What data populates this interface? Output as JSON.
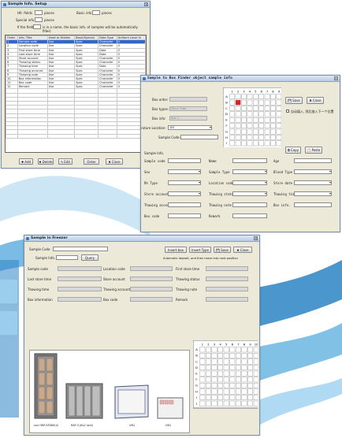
{
  "colors": {
    "accent": "#3168c6",
    "selected_cell": "#e02020",
    "window_bg": "#ece9d8",
    "swoosh": "#2c84c4"
  },
  "win1": {
    "title": "Sample Info. Setup",
    "top": {
      "hfr_fields_label": "Hfr. fields",
      "pieces1": "pieces",
      "basic_info_label": "Basic info",
      "pieces2": "pieces",
      "special_info_label": "Special info",
      "pieces3": "pieces",
      "if_the_field_label": "If the field",
      "note": "is in a name, the basic info. of samples will be automatically filled."
    },
    "columns": [
      "Order",
      "Info. Title",
      "Used or Hidden",
      "Basic/Special",
      "Data Type",
      "Uniform Level In"
    ],
    "rows": [
      [
        "1",
        "Sample code",
        "Use",
        "Spec",
        "Character",
        "0"
      ],
      [
        "2",
        "Location code",
        "Use",
        "Spec",
        "Character",
        "0"
      ],
      [
        "3",
        "First store time",
        "Use",
        "Spec",
        "Date",
        "0"
      ],
      [
        "4",
        "Last store time",
        "Use",
        "Spec",
        "Date",
        "0"
      ],
      [
        "5",
        "Store account",
        "Use",
        "Spec",
        "Character",
        "0"
      ],
      [
        "6",
        "Thawing status",
        "Use",
        "Spec",
        "Character",
        "0"
      ],
      [
        "7",
        "Thawing time",
        "Use",
        "Spec",
        "Date",
        "0"
      ],
      [
        "8",
        "Thawing account",
        "Use",
        "Spec",
        "Character",
        "0"
      ],
      [
        "9",
        "Thawing note",
        "Use",
        "Spec",
        "Character",
        "0"
      ],
      [
        "10",
        "Box information",
        "Use",
        "Spec",
        "Character",
        "0"
      ],
      [
        "11",
        "Box code",
        "Use",
        "Spec",
        "Character",
        "0"
      ],
      [
        "12",
        "Remark",
        "Use",
        "Spec",
        "Character",
        "0"
      ]
    ],
    "buttons": {
      "add": "Add",
      "delete": "Delete",
      "edit": "Edit",
      "order": "Order",
      "close": "Close"
    }
  },
  "win2": {
    "title": "Sample to Box Finder object sample info",
    "fields": {
      "box_order": "Box order:",
      "box_types": "Box types:",
      "box_types_value": "Micro Tube",
      "box_info": "Box info:",
      "box_info_value": "Box 1",
      "temp_label": "rature Location:",
      "temp_value": "-80",
      "sample_code": "Sample Code:"
    },
    "buttons": {
      "save": "Save",
      "close": "Close",
      "copy": "Copy",
      "paste": "Paste"
    },
    "check_label": "自动填入, 然后放入下一个位置",
    "sample_info_label": "Sample Info.",
    "grid_cols": [
      "1",
      "2",
      "3",
      "4",
      "5",
      "6",
      "7",
      "8",
      "9"
    ],
    "grid_rows": [
      "A",
      "B",
      "C",
      "D",
      "E",
      "F",
      "G",
      "H",
      "I"
    ],
    "form": [
      [
        "Sample code",
        "Name",
        "Age"
      ],
      [
        "Sex",
        "Sample Type",
        "Blood Type"
      ],
      [
        "Rh Type",
        "Location code",
        "Store date"
      ],
      [
        "Store account",
        "Thawing state",
        "Thawing time"
      ],
      [
        "Thawing acces",
        "Thawing note",
        "Box info."
      ],
      [
        "Box code",
        "Remark",
        ""
      ]
    ]
  },
  "win3": {
    "title": "Sample in Freezer",
    "sample_code_label": "Sample Code",
    "sample_info_label": "Sample Info.",
    "query_btn": "Query",
    "top_buttons": {
      "insert": "Insert box",
      "insert_type": "Insert Type",
      "save": "Save",
      "close": "Close"
    },
    "note": "Automatic deposit, and then move into next position",
    "fields": [
      [
        "Sample code",
        "Location code",
        "First store time"
      ],
      [
        "Last store time",
        "Store account",
        "Thawing status"
      ],
      [
        "Thawing time",
        "Thawing account",
        "Thawing note"
      ],
      [
        "Box information",
        "Box code",
        "Remark"
      ]
    ],
    "rack_labels": {
      "freezer": "-xxx HKP-SR360(4)",
      "rack": "RAP-3 (8x2 rack)",
      "box1": "UN1",
      "box2": "UN1"
    },
    "grid_cols": [
      "1",
      "2",
      "3",
      "4",
      "5",
      "6",
      "7",
      "8",
      "9",
      "10"
    ],
    "grid_rows": [
      "A",
      "B",
      "C",
      "D",
      "E",
      "F",
      "G",
      "H",
      "I",
      "J"
    ]
  }
}
